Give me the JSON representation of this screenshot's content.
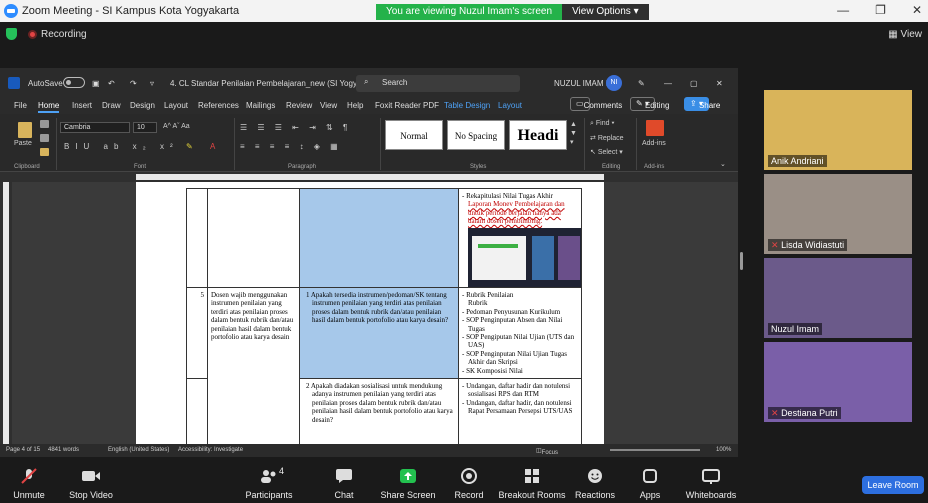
{
  "zoom": {
    "window_title": "Zoom Meeting - SI Kampus Kota Yogyakarta",
    "viewing_msg": "You are viewing Nuzul Imam's screen",
    "view_options": "View Options",
    "recording": "Recording",
    "view": "View"
  },
  "word": {
    "autosave": "AutoSave",
    "doc_title": "4. CL Standar Penilaian Pembelajaran_new (SI Yogya...",
    "search": "Search",
    "user": "NUZUL IMAM F",
    "user_initials": "NI",
    "menu": [
      "File",
      "Home",
      "Insert",
      "Draw",
      "Design",
      "Layout",
      "References",
      "Mailings",
      "Review",
      "View",
      "Help",
      "Foxit Reader PDF",
      "Table Design",
      "Layout"
    ],
    "comments": "Comments",
    "editing": "Editing",
    "share": "Share",
    "font": "Cambria",
    "size": "10",
    "styles": [
      "Normal",
      "No Spacing",
      "Headi"
    ],
    "find": "Find",
    "replace": "Replace",
    "select": "Select",
    "addins": "Add-ins",
    "paste": "Paste",
    "groups": [
      "Clipboard",
      "Font",
      "Paragraph",
      "Styles",
      "Editing",
      "Add-ins"
    ],
    "status": {
      "page": "Page 4 of 15",
      "words": "4841 words",
      "lang": "English (United States)",
      "access": "Accessibility: Investigate",
      "focus": "Focus",
      "zoom": "100%"
    }
  },
  "table": {
    "r1_c4_title": "Rekapitulasi Nilai Tugas Akhir",
    "r1_c4_red": "Laporan Monev Pembelajaran dan untuk periode berjalan hanya ada dalam dosen pembimbing.",
    "r2_no": "5",
    "r2_c2": "Dosen wajib menggunakan instrumen penilaian yang terdiri atas penilaian proses dalam bentuk rubrik dan/atau penilaian hasil dalam bentuk portofolio atau karya desain",
    "r2_c3_num": "1",
    "r2_c3": "Apakah tersedia instrumen/pedoman/SK tentang instrumen penilaian yang terdiri atas penilaian proses dalam bentuk rubrik dan/atau penilaian hasil dalam bentuk portofolio atau karya desain?",
    "r2_c4": [
      "Rubrik Penilaian",
      "Rubrik",
      "Pedoman Penyusunan Kurikulum",
      "SOP Penginputan Absen dan Nilai Tugas",
      "SOP Pengiputan Nilai Ujian (UTS dan UAS)",
      "SOP Penginputan Nilai Ujian Tugas Akhir dan Skripsi",
      "SK Komposisi Nilai"
    ],
    "r3_c3_num": "2",
    "r3_c3": "Apakah diadakan sosialisasi untuk mendukung adanya instrumen penilaian yang terdiri atas penilaian proses dalam bentuk rubrik dan/atau penilaian hasil dalam bentuk portofolio atau karya desain?",
    "r3_c4": [
      "Undangan, daftar hadir dan notulensi sosialisasi RPS dan RTM",
      "Undangan, daftar hadir, dan notulensi Rapat Persamaan Persepsi UTS/UAS"
    ]
  },
  "participants": [
    {
      "name": "Anik Andriani",
      "bg": "#d9b45a"
    },
    {
      "name": "Lisda Widiastuti",
      "bg": "#9a8f86"
    },
    {
      "name": "Nuzul Imam",
      "bg": "#6b5a8a"
    },
    {
      "name": "Destiana Putri",
      "bg": "#7a5fa8"
    }
  ],
  "toolbar": {
    "unmute": "Unmute",
    "stop_video": "Stop Video",
    "participants": "Participants",
    "participants_count": "4",
    "chat": "Chat",
    "share_screen": "Share Screen",
    "record": "Record",
    "breakout": "Breakout Rooms",
    "reactions": "Reactions",
    "apps": "Apps",
    "whiteboards": "Whiteboards",
    "leave": "Leave Room"
  }
}
